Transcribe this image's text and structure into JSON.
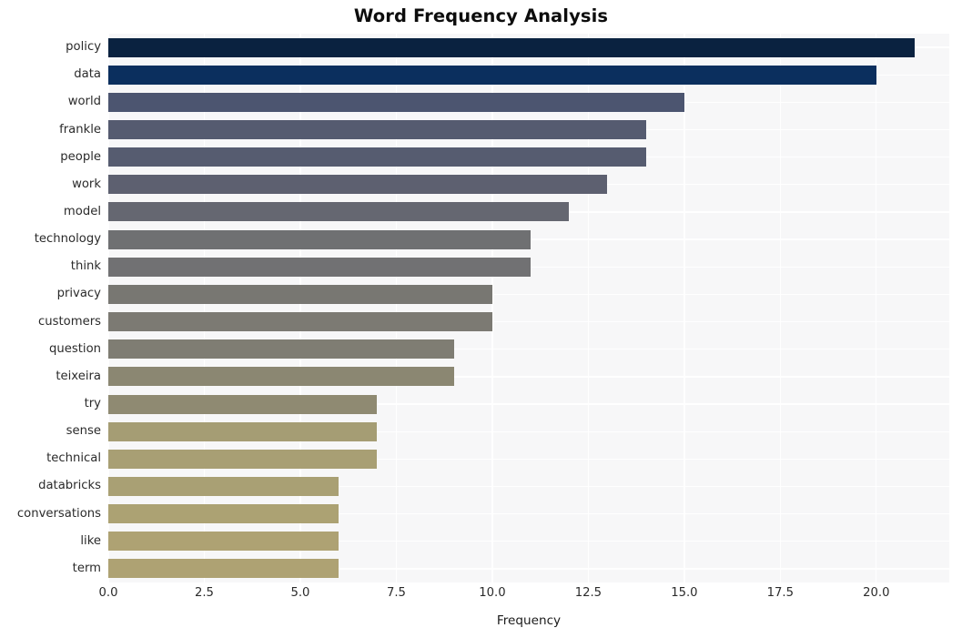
{
  "chart_data": {
    "type": "bar",
    "orientation": "horizontal",
    "title": "Word Frequency Analysis",
    "xlabel": "Frequency",
    "ylabel": "",
    "categories": [
      "policy",
      "data",
      "world",
      "frankle",
      "people",
      "work",
      "model",
      "technology",
      "think",
      "privacy",
      "customers",
      "question",
      "teixeira",
      "try",
      "sense",
      "technical",
      "databricks",
      "conversations",
      "like",
      "term"
    ],
    "values": [
      21,
      20,
      15,
      14,
      14,
      13,
      12,
      11,
      11,
      10,
      10,
      9,
      9,
      7,
      7,
      7,
      6,
      6,
      6,
      6
    ],
    "bar_colors": [
      "#0a2240",
      "#0b2f5e",
      "#4c5570",
      "#555b70",
      "#565c70",
      "#5d6070",
      "#656771",
      "#6f7072",
      "#717173",
      "#787772",
      "#7c7a73",
      "#7f7d73",
      "#8b8772",
      "#8f8a72",
      "#a59d74",
      "#a89f74",
      "#a9a074",
      "#aca273",
      "#aea273",
      "#aea273"
    ],
    "xticks": [
      0.0,
      2.5,
      5.0,
      7.5,
      10.0,
      12.5,
      15.0,
      17.5,
      20.0
    ],
    "xtick_labels": [
      "0.0",
      "2.5",
      "5.0",
      "7.5",
      "10.0",
      "12.5",
      "15.0",
      "17.5",
      "20.0"
    ],
    "xlim": [
      0,
      21.9
    ],
    "grid": true,
    "grid_color": "#ffffff",
    "plot_background": "#f7f7f8",
    "figure_background": "#ffffff",
    "legend": null
  }
}
